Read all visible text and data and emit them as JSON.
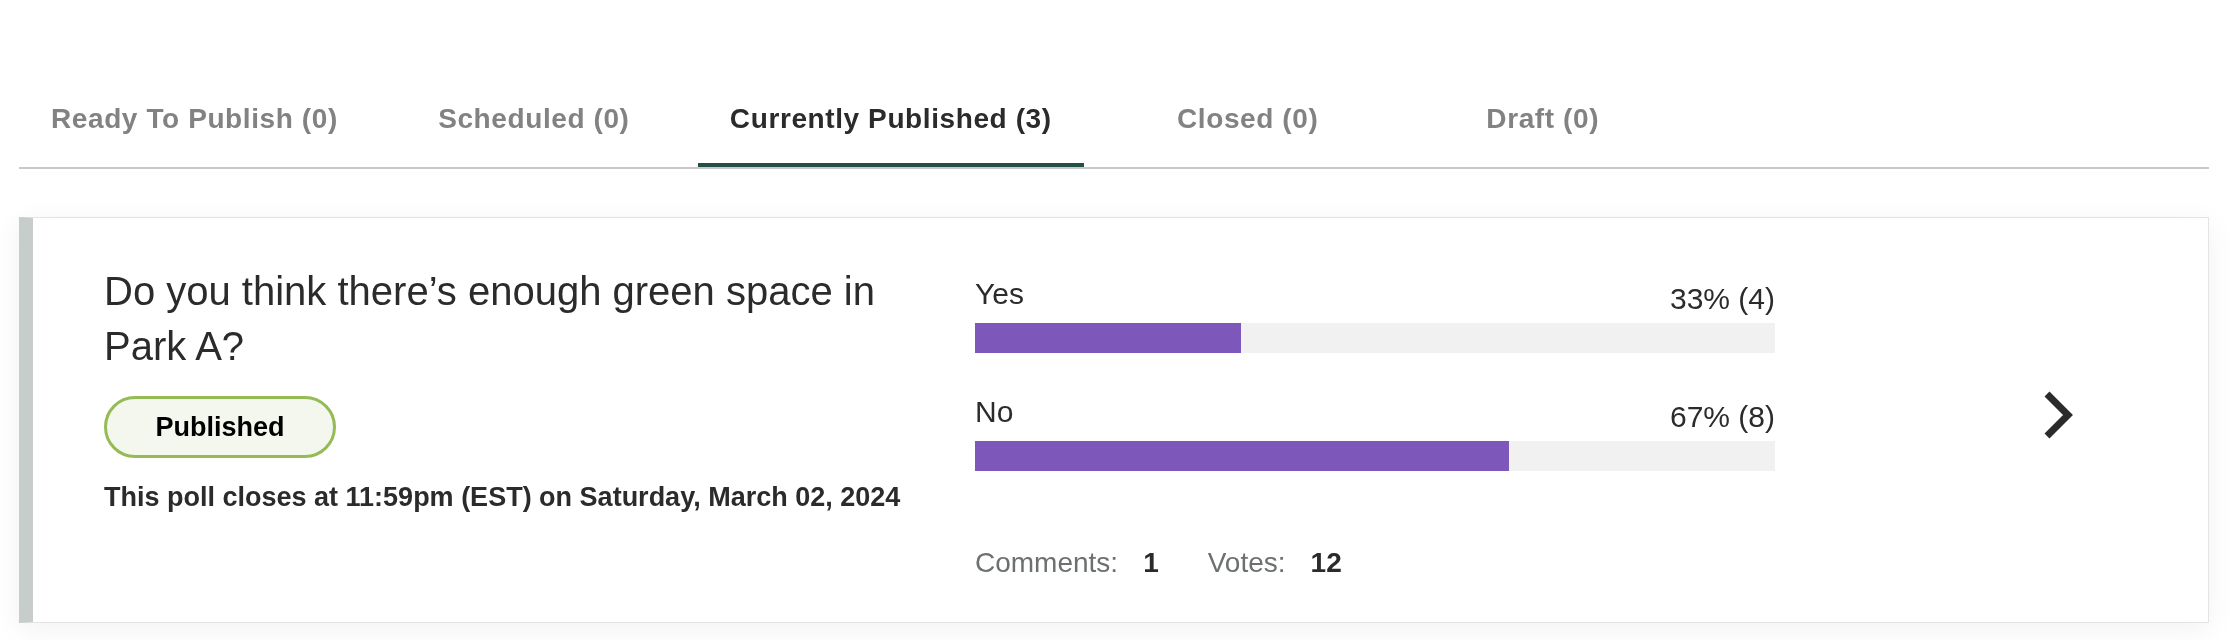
{
  "tabs": [
    {
      "label": "Ready To Publish (0)",
      "selected": false
    },
    {
      "label": "Scheduled (0)",
      "selected": false
    },
    {
      "label": "Currently Published (3)",
      "selected": true
    },
    {
      "label": "Closed (0)",
      "selected": false
    },
    {
      "label": "Draft (0)",
      "selected": false
    }
  ],
  "polls": [
    {
      "question": "Do you think there’s enough green space in Park A?",
      "status": "Published",
      "closing_note": "This poll closes at 11:59pm (EST) on Saturday, March 02, 2024",
      "options": [
        {
          "label": "Yes",
          "result": "33% (4)",
          "level": 0.333
        },
        {
          "label": "No",
          "result": "67% (8)",
          "level": 0.667
        }
      ],
      "stats": [
        {
          "label": "Comments:",
          "value": "1"
        },
        {
          "label": "Votes:",
          "value": "12"
        }
      ]
    }
  ]
}
